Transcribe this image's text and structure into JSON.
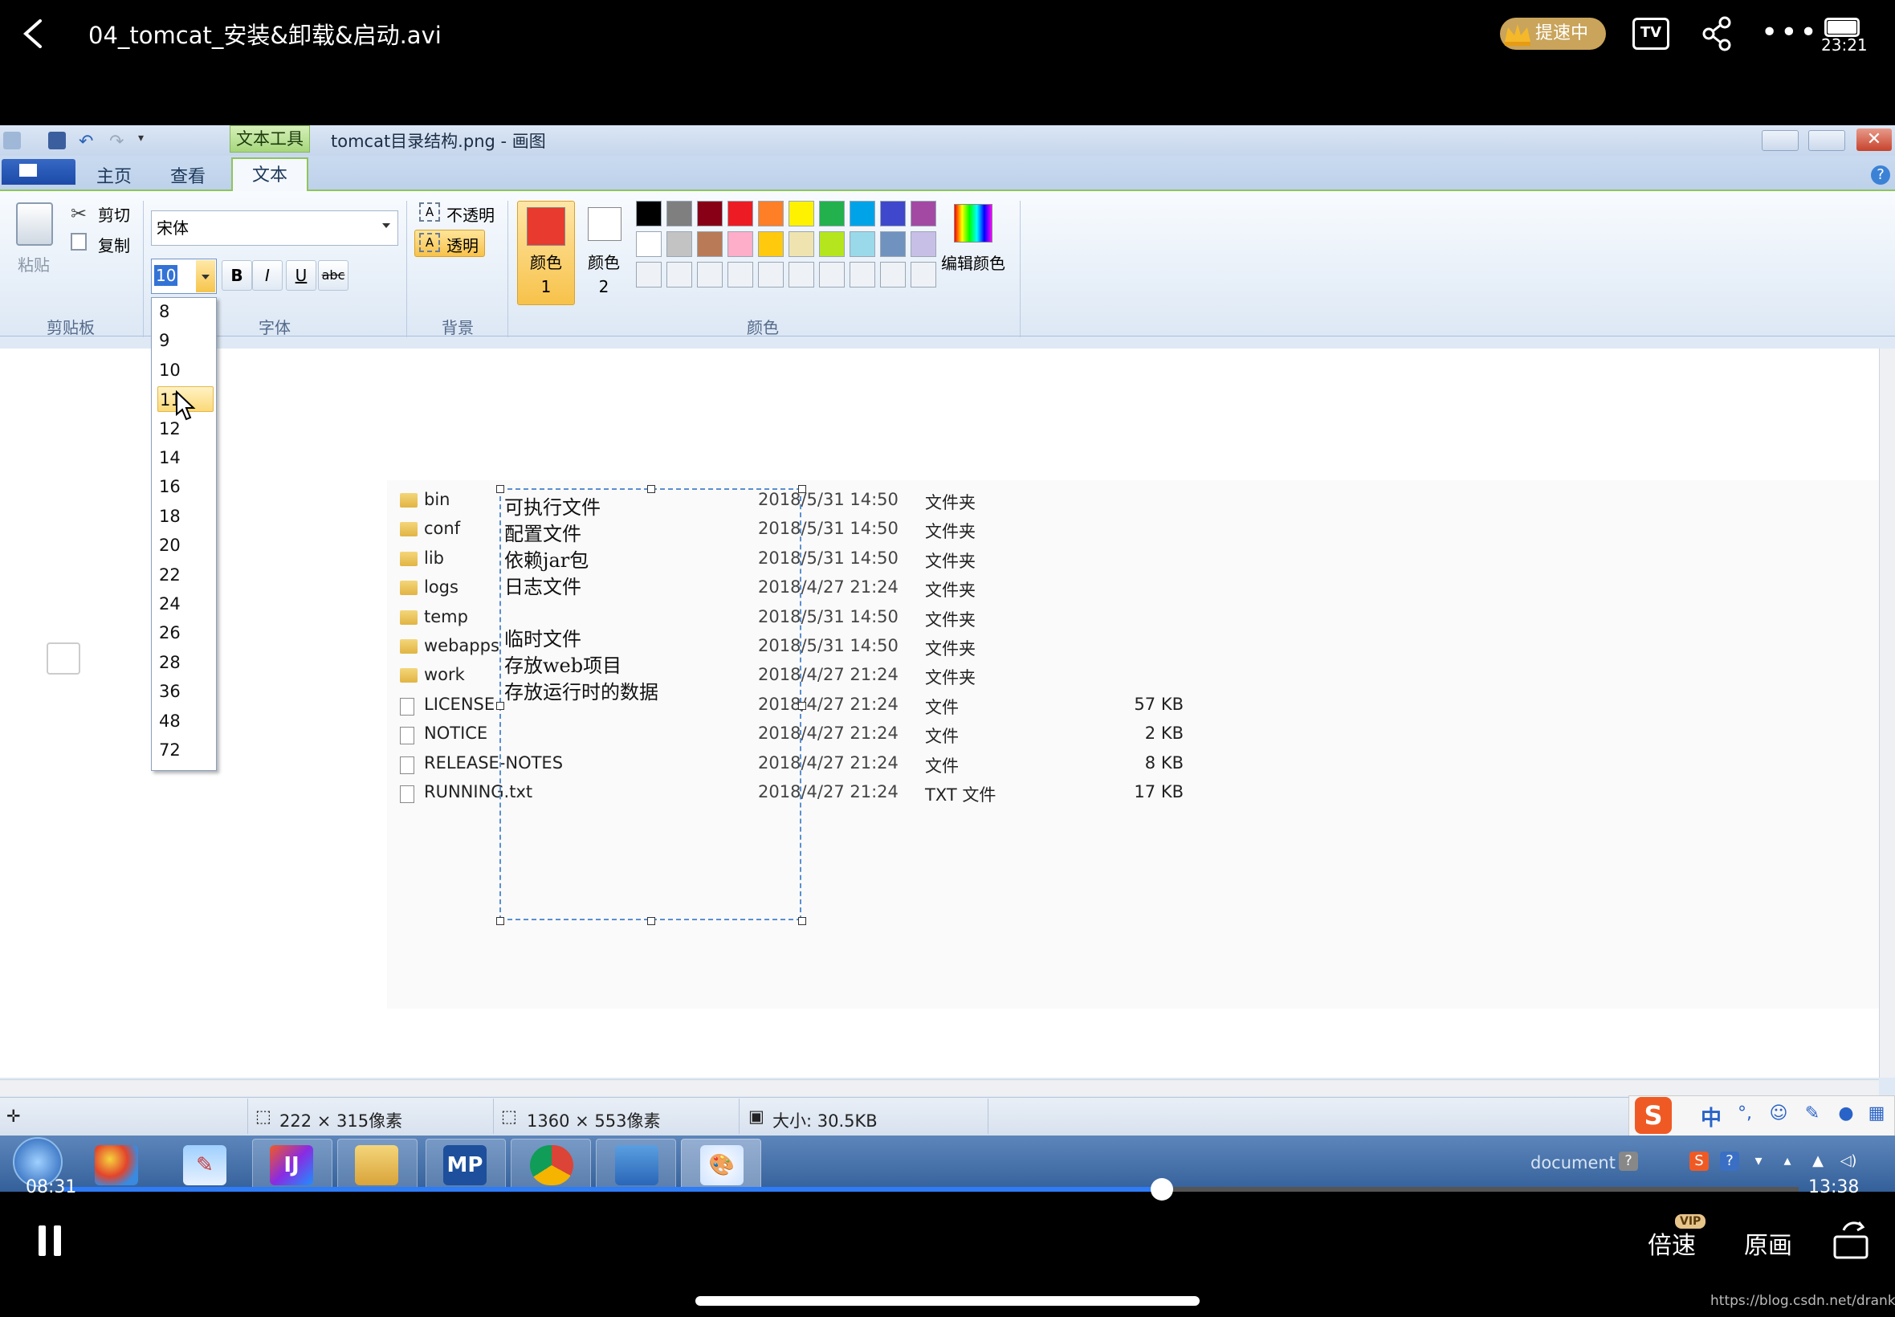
{
  "player": {
    "title": "04_tomcat_安装&卸载&启动.avi",
    "speed_badge": "提速中",
    "tv_label": "TV",
    "clock": "23:21",
    "time_current": "08:31",
    "time_total": "13:38",
    "progress": 0.633,
    "speed_label": "倍速",
    "vip_label": "VIP",
    "quality_label": "原画",
    "watermark": "https://blog.csdn.net/drankness"
  },
  "paint": {
    "context_tab": "文本工具",
    "window_title": "tomcat目录结构.png - 画图",
    "tabs": [
      "主页",
      "查看",
      "文本"
    ],
    "active_tab": "文本",
    "help": "?",
    "clipboard": {
      "paste": "粘贴",
      "cut": "剪切",
      "copy": "复制",
      "group": "剪贴板"
    },
    "font": {
      "family": "宋体",
      "size": "10",
      "group": "字体",
      "bold": "B",
      "italic": "I",
      "underline": "U",
      "strike": "abc"
    },
    "background": {
      "opaque": "不透明",
      "transparent": "透明",
      "group": "背景"
    },
    "colors": {
      "color1_label": "颜色 1",
      "color2_label": "颜色 2",
      "color1": "#e83a2e",
      "color2": "#ffffff",
      "edit_label": "编辑颜色",
      "group": "颜色",
      "palette_row1": [
        "#000000",
        "#7f7f7f",
        "#880015",
        "#ed1c24",
        "#ff7f27",
        "#fff200",
        "#22b14c",
        "#00a2e8",
        "#3f48cc",
        "#a349a4"
      ],
      "palette_row2": [
        "#ffffff",
        "#c3c3c3",
        "#b97a57",
        "#ffaec9",
        "#ffc90e",
        "#efe4b0",
        "#b5e61d",
        "#99d9ea",
        "#7092be",
        "#c8bfe7"
      ]
    },
    "size_options": [
      "8",
      "9",
      "10",
      "11",
      "12",
      "14",
      "16",
      "18",
      "20",
      "22",
      "24",
      "26",
      "28",
      "36",
      "48",
      "72"
    ],
    "size_hover": "11",
    "files": [
      {
        "name": "bin",
        "date": "2018/5/31 14:50",
        "type": "文件夹",
        "size": "",
        "folder": true
      },
      {
        "name": "conf",
        "date": "2018/5/31 14:50",
        "type": "文件夹",
        "size": "",
        "folder": true
      },
      {
        "name": "lib",
        "date": "2018/5/31 14:50",
        "type": "文件夹",
        "size": "",
        "folder": true
      },
      {
        "name": "logs",
        "date": "2018/4/27 21:24",
        "type": "文件夹",
        "size": "",
        "folder": true
      },
      {
        "name": "temp",
        "date": "2018/5/31 14:50",
        "type": "文件夹",
        "size": "",
        "folder": true
      },
      {
        "name": "webapps",
        "date": "2018/5/31 14:50",
        "type": "文件夹",
        "size": "",
        "folder": true
      },
      {
        "name": "work",
        "date": "2018/4/27 21:24",
        "type": "文件夹",
        "size": "",
        "folder": true
      },
      {
        "name": "LICENSE",
        "date": "2018/4/27 21:24",
        "type": "文件",
        "size": "57 KB",
        "folder": false
      },
      {
        "name": "NOTICE",
        "date": "2018/4/27 21:24",
        "type": "文件",
        "size": "2 KB",
        "folder": false
      },
      {
        "name": "RELEASE-NOTES",
        "date": "2018/4/27 21:24",
        "type": "文件",
        "size": "8 KB",
        "folder": false
      },
      {
        "name": "RUNNING.txt",
        "date": "2018/4/27 21:24",
        "type": "TXT 文件",
        "size": "17 KB",
        "folder": false
      }
    ],
    "annotations": [
      "可执行文件",
      "配置文件",
      "依赖jar包",
      "日志文件",
      "临时文件",
      "存放web项目",
      "存放运行时的数据"
    ],
    "status": {
      "selection": "222 × 315像素",
      "image_size": "1360 × 553像素",
      "file_size": "大小: 30.5KB"
    },
    "ime": {
      "logo": "S",
      "lang": "中"
    }
  },
  "taskbar": {
    "apps": [
      "Picasa",
      "Pencils",
      "IntelliJ IDEA",
      "File Explorer",
      "MP",
      "Chrome",
      "WinRAR",
      "Paint"
    ],
    "idea_label": "IJ",
    "mp_label": "MP",
    "tray_text": "document"
  }
}
